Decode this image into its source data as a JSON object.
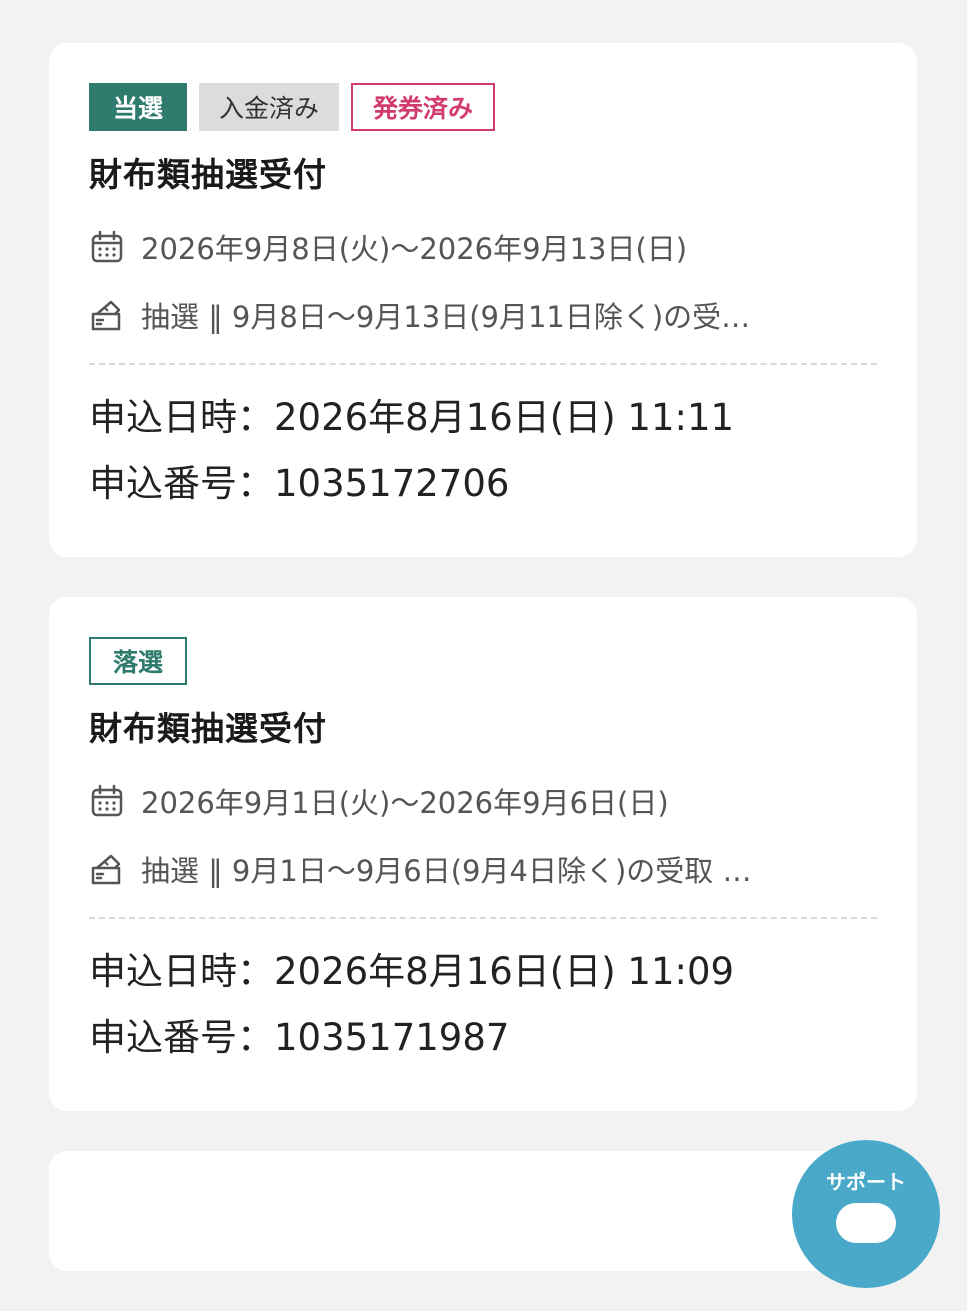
{
  "entries": [
    {
      "badges": {
        "result": "当選",
        "payment": "入金済み",
        "ticket": "発券済み"
      },
      "title": "財布類抽選受付",
      "period": "2026年9月8日(火)〜2026年9月13日(日)",
      "lottery": "抽選 ‖ 9月8日〜9月13日(9月11日除く)の受…",
      "applied_at": "申込日時：2026年8月16日(日) 11:11",
      "application_no": "申込番号：1035172706"
    },
    {
      "badges": {
        "result": "落選"
      },
      "title": "財布類抽選受付",
      "period": "2026年9月1日(火)〜2026年9月6日(日)",
      "lottery": "抽選 ‖ 9月1日〜9月6日(9月4日除く)の受取 …",
      "applied_at": "申込日時：2026年8月16日(日) 11:09",
      "application_no": "申込番号：1035171987"
    }
  ],
  "support_button": {
    "label": "サポート",
    "icon": "chat-bubble-icon"
  },
  "icons": {
    "calendar": "calendar-icon",
    "ticket": "ticket-icon"
  },
  "colors": {
    "win": "#2f7b6d",
    "issued": "#d23c6d",
    "paid_bg": "#dcdcdc",
    "support": "#4aa9c9"
  }
}
